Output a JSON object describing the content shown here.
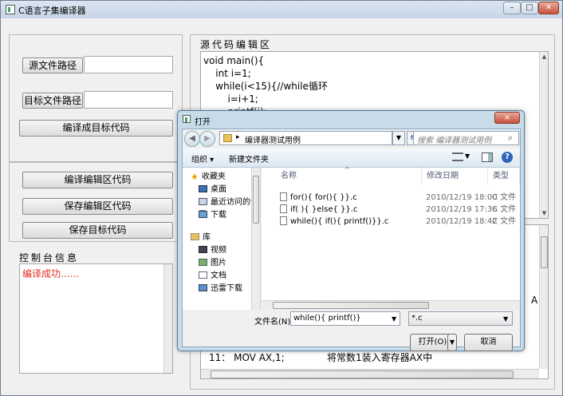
{
  "window": {
    "title": "C语言子集编译器"
  },
  "left": {
    "source_path_label": "源文件路径",
    "source_path_value": "",
    "target_path_label": "目标文件路径",
    "target_path_value": "",
    "compile_target_label": "编译成目标代码",
    "compile_editor_label": "编译编辑区代码",
    "save_editor_label": "保存编辑区代码",
    "save_target_label": "保存目标代码",
    "console_title": "控制台信息",
    "console_message": "编译成功......"
  },
  "editor": {
    "title": "源代码编辑区",
    "lines": [
      "void main(){",
      "    int i=1;",
      "    while(i<15){//while循环",
      "        i=i+1;",
      "        printf(i);"
    ]
  },
  "output": {
    "visible_line": "11： MOV AX,1;              将常数1装入寄存器AX中",
    "partial_right_text": "A"
  },
  "dialog": {
    "title": "打开",
    "close_label": "×",
    "address_path": "编译器测试用例",
    "search_placeholder": "搜索 编译器测试用例",
    "toolbar": {
      "organize": "组织 ▾",
      "new_folder": "新建文件夹"
    },
    "nav": {
      "favorites_label": "收藏夹",
      "favorites": [
        "桌面",
        "最近访问的位置",
        "下载"
      ],
      "libraries_label": "库",
      "libraries": [
        "视频",
        "图片",
        "文档",
        "迅雷下载"
      ]
    },
    "columns": {
      "name": "名称",
      "date": "修改日期",
      "type": "类型"
    },
    "files": [
      {
        "name": "for(){ for(){ }}.c",
        "date": "2010/12/19 18:00",
        "type": "C 文件"
      },
      {
        "name": "if( ){ }else{ }}.c",
        "date": "2010/12/19 17:36",
        "type": "C 文件"
      },
      {
        "name": "while(){ if(){ printf()}}.c",
        "date": "2010/12/19 18:42",
        "type": "C 文件"
      }
    ],
    "filename_label": "文件名(N):",
    "filename_value": "while(){ printf()}",
    "filter_value": "*.c",
    "open_label": "打开(O)",
    "cancel_label": "取消"
  }
}
